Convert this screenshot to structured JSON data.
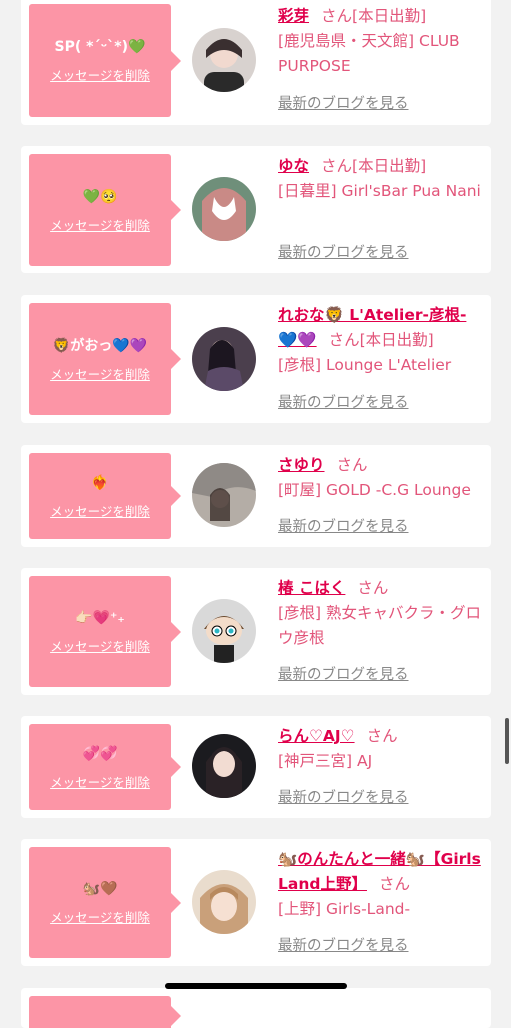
{
  "cards": [
    {
      "message": "SP( *ˊᵕˋ*)💚",
      "delete_label": "メッセージを削除",
      "name": "彩芽",
      "san": "さん",
      "status": "[本日出勤]",
      "shop": "[鹿児島県・天文館] CLUB PURPOSE",
      "blog_label": "最新のブログを見る",
      "avatar_color": "#3a2f30"
    },
    {
      "message": "💚🥺",
      "delete_label": "メッセージを削除",
      "name": "ゆな",
      "san": "さん",
      "status": "[本日出勤]",
      "shop": "[日暮里] Girl'sBar Pua Nani",
      "blog_label": "最新のブログを見る",
      "avatar_color": "#c98a86"
    },
    {
      "message": "🦁がおっ💙💜",
      "delete_label": "メッセージを削除",
      "name": "れおな🦁 L'Atelier-彦根-💙💜",
      "san": "さん",
      "status": "[本日出勤]",
      "shop": "[彦根] Lounge L'Atelier",
      "blog_label": "最新のブログを見る",
      "avatar_color": "#2b2230"
    },
    {
      "message": "❤️‍🔥",
      "delete_label": "メッセージを削除",
      "name": "さゆり",
      "san": "さん",
      "status": "",
      "shop": "[町屋] GOLD -C.G Lounge",
      "blog_label": "最新のブログを見る",
      "avatar_color": "#8f8a86"
    },
    {
      "message": "👉🏻💗⁺₊",
      "delete_label": "メッセージを削除",
      "name": "椿 こはく",
      "san": "さん",
      "status": "",
      "shop": "[彦根] 熟女キャバクラ・グロウ彦根",
      "blog_label": "最新のブログを見る",
      "avatar_color": "#d9d9d9"
    },
    {
      "message": "💞💞",
      "delete_label": "メッセージを削除",
      "name": "らん♡AJ♡",
      "san": "さん",
      "status": "",
      "shop": "[神戸三宮] AJ",
      "blog_label": "最新のブログを見る",
      "avatar_color": "#1b1b1f"
    },
    {
      "message": "🐿️🤎",
      "delete_label": "メッセージを削除",
      "name": "🐿️のんたんと一緒🐿️【Girls Land上野】",
      "san": "さん",
      "status": "",
      "shop": "[上野] Girls-Land-",
      "blog_label": "最新のブログを見る",
      "avatar_color": "#c9a07a"
    }
  ]
}
